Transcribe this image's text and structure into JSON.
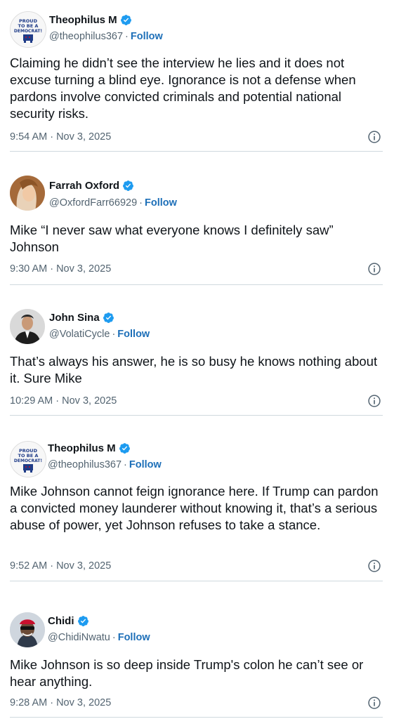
{
  "tweets": [
    {
      "name": "Theophilus M",
      "handle": "@theophilus367",
      "follow": "Follow",
      "avatar_text": [
        "PROUD",
        "TO BE A",
        "DEMOCRAT!"
      ],
      "text": "Claiming he didn’t see the interview he lies and it does not excuse turning a blind eye. Ignorance is not a defense when pardons involve convicted criminals and potential national security risks.",
      "time": "9:54 AM · Nov 3, 2025"
    },
    {
      "name": "Farrah Oxford",
      "handle": "@OxfordFarr66929",
      "follow": "Follow",
      "text": "Mike “I never saw what everyone knows I definitely saw” Johnson",
      "time": "9:30 AM · Nov 3, 2025"
    },
    {
      "name": "John Sina",
      "handle": "@VolatiCycle",
      "follow": "Follow",
      "text": "That’s always his answer, he is so busy he knows nothing about it. Sure Mike",
      "time": "10:29 AM · Nov 3, 2025"
    },
    {
      "name": "Theophilus M",
      "handle": "@theophilus367",
      "follow": "Follow",
      "avatar_text": [
        "PROUD",
        "TO BE A",
        "DEMOCRAT!"
      ],
      "text": "Mike Johnson cannot feign ignorance here. If Trump can pardon a convicted money launderer without knowing it, that’s a serious abuse of power, yet Johnson refuses to take a stance.",
      "time": "9:52 AM · Nov 3, 2025"
    },
    {
      "name": "Chidi",
      "handle": "@ChidiNwatu",
      "follow": "Follow",
      "text": "Mike Johnson is so deep inside Trump's colon he can’t see or hear anything.",
      "time": "9:28 AM · Nov 3, 2025"
    }
  ],
  "colors": {
    "verified": "#1d9bf0",
    "follow": "#1d6fb8",
    "secondary_text": "#536471",
    "divider": "#cfd9de"
  },
  "icons": {
    "verified": "verified-badge-icon",
    "info": "info-icon"
  }
}
